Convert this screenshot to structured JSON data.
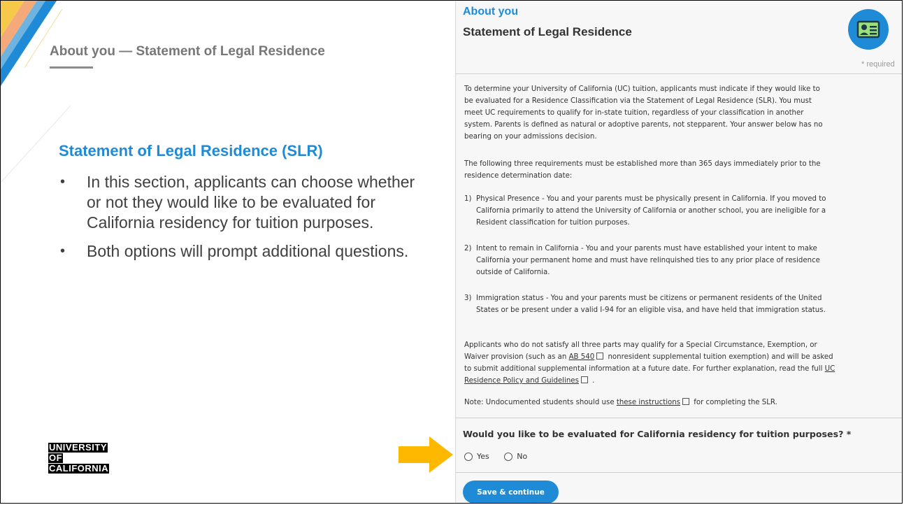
{
  "slide": {
    "title": "About you — Statement of Legal Residence",
    "section_heading": "Statement of Legal Residence (SLR)",
    "bullets": [
      "In this section, applicants can choose whether or not they would like to be evaluated for California residency for tuition purposes.",
      "Both options will prompt additional questions."
    ],
    "logo": [
      "UNIVERSITY",
      "OF",
      "CALIFORNIA"
    ],
    "arrow_icon": "right-arrow-icon",
    "colors": {
      "accent_blue": "#1f8ad6",
      "arrow_orange": "#ffb800",
      "deco_yellow": "#f7c94b"
    }
  },
  "panel": {
    "section_label": "About you",
    "heading": "Statement of Legal Residence",
    "icon": "id-card-icon",
    "required_note": "* required",
    "intro": "To determine your University of California (UC) tuition, applicants must indicate if they would like to be evaluated for a Residence Classification via the Statement of Legal Residence (SLR). You must meet UC requirements to qualify for in-state tuition, regardless of your classification in another system. Parents is defined as natural or adoptive parents, not stepparent. Your answer below has no bearing on your admissions decision.",
    "requirements_intro": "The following three requirements must be established more than 365 days immediately prior to the residence determination date:",
    "requirements": [
      {
        "num": "1)",
        "text": "Physical Presence - You and your parents must be physically present in California. If you moved to California primarily to attend the University of California or another school, you are ineligible for a Resident classification for tuition purposes."
      },
      {
        "num": "2)",
        "text": "Intent to remain in California - You and your parents must have established your intent to make California your permanent home and must have relinquished ties to any prior place of residence outside of California."
      },
      {
        "num": "3)",
        "text": "Immigration status - You and your parents must be citizens or permanent residents of the United States or be present under a valid I-94 for an eligible visa, and have held that immigration status."
      }
    ],
    "exemption": {
      "part1": "Applicants who do not satisfy all three parts may qualify for a Special Circumstance, Exemption, or Waiver provision (such as an ",
      "link1": "AB 540",
      "part2": " nonresident supplemental tuition exemption) and will be asked to submit additional supplemental information at a future date. For further explanation, read the full ",
      "link2": "UC Residence Policy and Guidelines",
      "part3": " ."
    },
    "note": {
      "part1": "Note: Undocumented students should use ",
      "link": "these instructions",
      "part2": " for completing the SLR."
    },
    "question": "Would you like to be evaluated for California residency for tuition purposes? *",
    "options": [
      "Yes",
      "No"
    ],
    "save_label": "Save & continue"
  }
}
